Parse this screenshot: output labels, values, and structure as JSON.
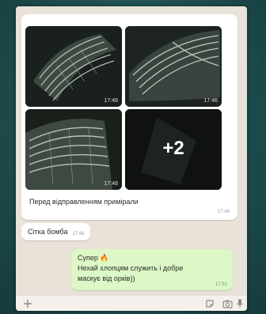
{
  "chat": {
    "photos": [
      {
        "time": "17:46"
      },
      {
        "time": "17:46"
      },
      {
        "time": "17:46"
      },
      {
        "more_count": "+2"
      }
    ],
    "photo_caption": "Перед відправленням примірали",
    "photo_caption_time": "17:46",
    "incoming_text": "Сітка бомба",
    "incoming_time": "17:48",
    "outgoing": {
      "line1": "Супер 🔥",
      "line2": "Нехай хлопцям служить і добре",
      "line3": "маскує від орків))",
      "time": "17:51"
    }
  },
  "colors": {
    "background": "#1f4f50",
    "chat_wallpaper": "#e8e2d8",
    "incoming_bubble": "#ffffff",
    "outgoing_bubble": "#dcf8c6"
  },
  "icons": {
    "attach": "plus-icon",
    "sticker": "sticker-icon",
    "camera": "camera-icon",
    "mic": "mic-icon"
  }
}
